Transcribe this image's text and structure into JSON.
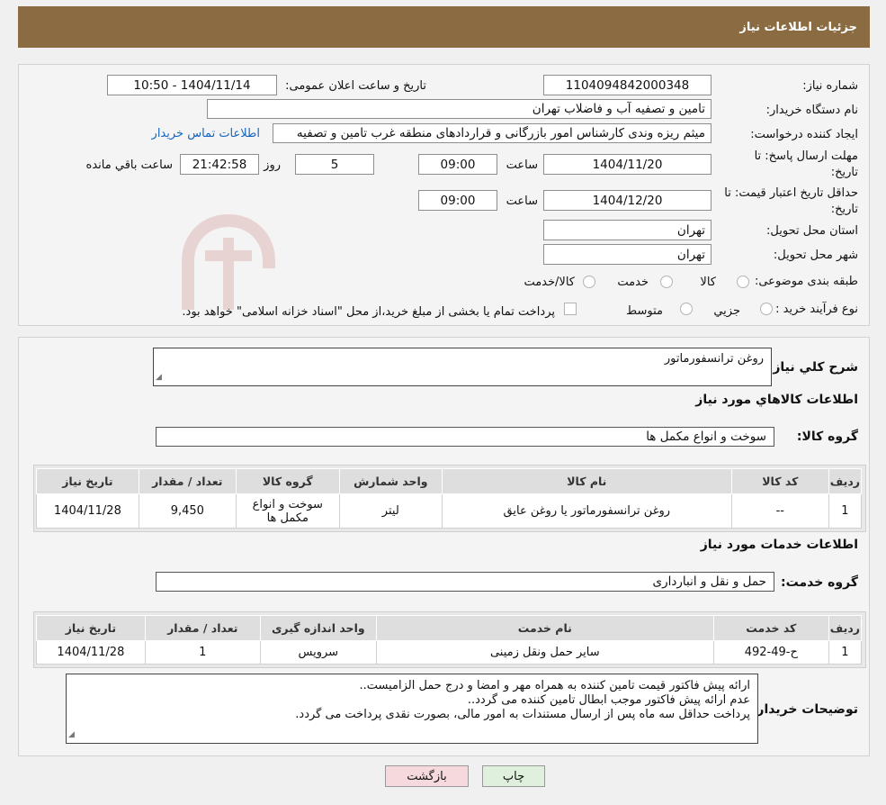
{
  "header": {
    "title": "جزئیات اطلاعات نیاز"
  },
  "form": {
    "need_number_label": "شماره نیاز:",
    "need_number": "1104094842000348",
    "announce_label": "تاریخ و ساعت اعلان عمومی:",
    "announce_value": "1404/11/14 - 10:50",
    "buyer_org_label": "نام دستگاه خریدار:",
    "buyer_org": "تامین و تصفیه آب و فاضلاب تهران",
    "requester_label": "ایجاد کننده درخواست:",
    "requester": "میثم ریزه وندی کارشناس امور بازرگانی و قراردادهای منطقه غرب تامین و تصفیه",
    "contact_link": "اطلاعات تماس خریدار",
    "deadline_label_1": "مهلت ارسال پاسخ: تا",
    "deadline_label_2": "تاریخ:",
    "deadline_date": "1404/11/20",
    "time_label": "ساعت",
    "deadline_time": "09:00",
    "days_value": "5",
    "days_label": "روز و",
    "remaining_time": "21:42:58",
    "remaining_label": "ساعت باقي مانده",
    "validity_label_1": "حداقل تاریخ اعتبار قیمت: تا",
    "validity_label_2": "تاریخ:",
    "validity_date": "1404/12/20",
    "validity_time": "09:00",
    "province_label": "استان محل تحویل:",
    "province": "تهران",
    "city_label": "شهر محل تحویل:",
    "city": "تهران",
    "category_label": "طبقه بندی موضوعی:",
    "category_options": [
      "کالا",
      "خدمت",
      "کالا/خدمت"
    ],
    "process_label": "نوع فرآیند خرید :",
    "process_options": [
      "جزيي",
      "متوسط"
    ],
    "payment_note": "پرداخت تمام یا بخشی از مبلغ خرید،از محل \"اسناد خزانه اسلامی\" خواهد بود."
  },
  "description": {
    "label": "شرح كلي نياز:",
    "value": "روغن ترانسفورماتور"
  },
  "goods": {
    "section_title": "اطلاعات كالاهاي مورد نياز",
    "group_label": "گروه كالا:",
    "group_value": "سوخت و انواع مکمل ها",
    "headers": [
      "رديف",
      "کد کالا",
      "نام کالا",
      "واحد شمارش",
      "گروه کالا",
      "تعداد / مقدار",
      "تاریخ نیاز"
    ],
    "rows": [
      [
        "1",
        "--",
        "روغن ترانسفورماتور یا روغن عایق",
        "لیتر",
        "سوخت و انواع مکمل ها",
        "9,450",
        "1404/11/28"
      ]
    ]
  },
  "services": {
    "section_title": "اطلاعات خدمات مورد نياز",
    "group_label": "گروه خدمت:",
    "group_value": "حمل و نقل و انبارداری",
    "headers": [
      "رديف",
      "کد خدمت",
      "نام خدمت",
      "واحد اندازه گیری",
      "تعداد / مقدار",
      "تاریخ نیاز"
    ],
    "rows": [
      [
        "1",
        "ح-49-492",
        "سایر حمل ونقل زمینی",
        "سرویس",
        "1",
        "1404/11/28"
      ]
    ]
  },
  "notes": {
    "label": "توضیحات خریدار:",
    "lines": [
      "ارائه پیش فاکتور قیمت تامین کننده به همراه مهر و امضا و درج حمل الزامیست..",
      "عدم ارائه پیش فاکتور موجب ابطال تامین کننده می گردد..",
      "پرداخت حداقل سه ماه پس از ارسال مستندات به امور مالی، بصورت نقدی پرداخت می گردد."
    ]
  },
  "buttons": {
    "print": "چاپ",
    "back": "بازگشت"
  },
  "watermark": {
    "text": "AriaTender.neT"
  },
  "colors": {
    "header": "#8b6c42",
    "link": "#1565c0",
    "back_button": "#f6d9dc",
    "print_button": "#dff1dd"
  }
}
